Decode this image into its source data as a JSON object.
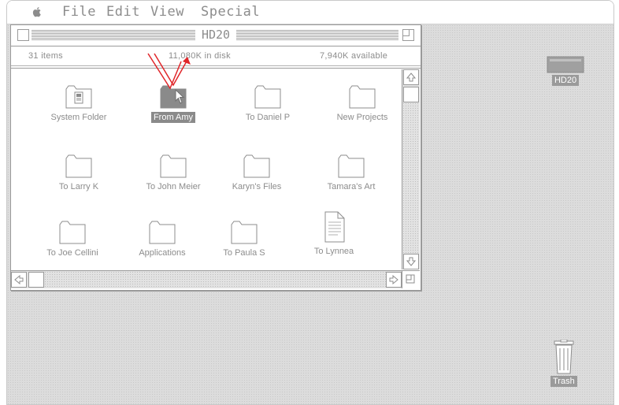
{
  "menubar": {
    "apple_icon": "apple-icon",
    "items": [
      "File",
      "Edit",
      "View",
      "Special"
    ]
  },
  "window": {
    "title": "HD20",
    "items_count": "31 items",
    "disk_used": "11,080K in disk",
    "available": "7,940K available"
  },
  "files": [
    {
      "label": "System Folder",
      "icon": "system-folder-icon"
    },
    {
      "label": "From Amy",
      "icon": "folder-icon",
      "selected": true
    },
    {
      "label": "To Daniel P",
      "icon": "folder-icon"
    },
    {
      "label": "New Projects",
      "icon": "folder-icon"
    },
    {
      "label": "To Larry K",
      "icon": "folder-icon"
    },
    {
      "label": "To John Meier",
      "icon": "folder-icon"
    },
    {
      "label": "Karyn's Files",
      "icon": "folder-icon"
    },
    {
      "label": "Tamara's Art",
      "icon": "folder-icon"
    },
    {
      "label": "To Joe Cellini",
      "icon": "folder-icon"
    },
    {
      "label": "Applications",
      "icon": "folder-icon"
    },
    {
      "label": "To Paula S",
      "icon": "folder-icon"
    },
    {
      "label": "To Lynnea",
      "icon": "document-icon"
    }
  ],
  "desktop": {
    "disk_label": "HD20",
    "trash_label": "Trash"
  },
  "colors": {
    "desktop": "#dcdcdc",
    "selection": "#8a8a8a",
    "annotation_arrow": "#e0262a"
  }
}
